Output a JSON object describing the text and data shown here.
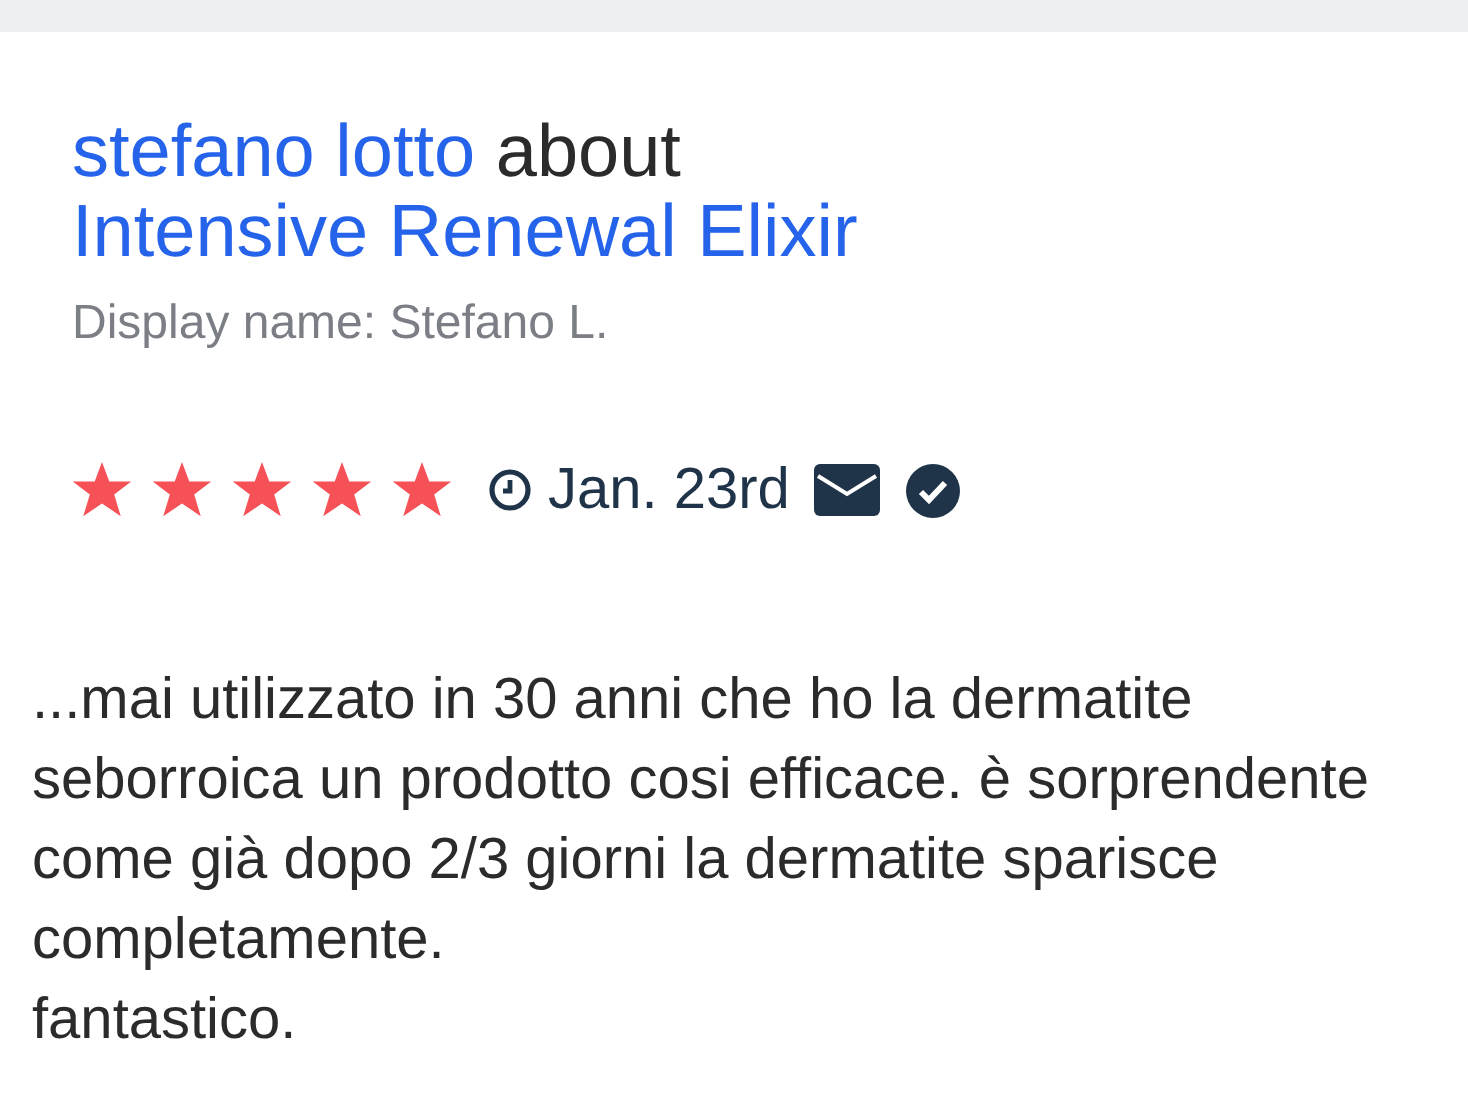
{
  "review": {
    "author": "stefano lotto",
    "connector": "about",
    "product": "Intensive Renewal Elixir",
    "display_name": "Display name: Stefano L.",
    "stars": 5,
    "date": "Jan. 23rd",
    "body": "...mai utilizzato in 30 anni che ho la dermatite\nseborroica un prodotto cosi efficace. è sorprendente\ncome già dopo 2/3 giorni la dermatite sparisce\ncompletamente.\nfantastico."
  }
}
